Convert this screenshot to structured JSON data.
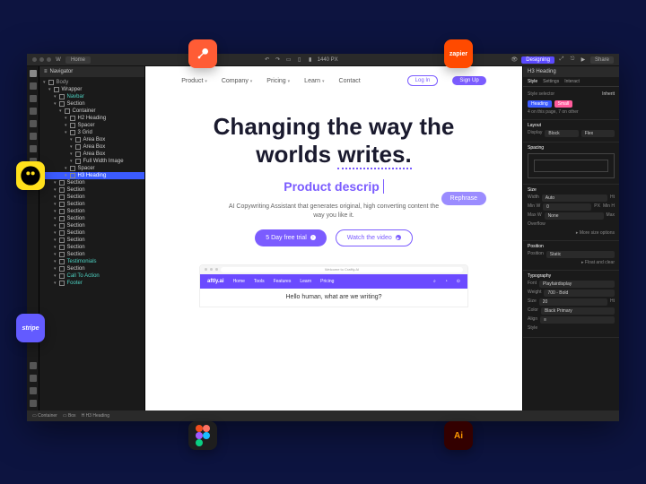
{
  "topbar": {
    "home": "Home",
    "width": "1440 PX",
    "designing": "Designing",
    "share": "Share"
  },
  "navigator": {
    "title": "Navigator",
    "tree": [
      {
        "label": "Body",
        "cls": "root"
      },
      {
        "label": "Wrapper",
        "cls": "ind1"
      },
      {
        "label": "Navbar",
        "cls": "ind2 teal"
      },
      {
        "label": "Section",
        "cls": "ind2"
      },
      {
        "label": "Container",
        "cls": "ind3"
      },
      {
        "label": "H2 Heading",
        "cls": "ind4"
      },
      {
        "label": "Spacer",
        "cls": "ind4"
      },
      {
        "label": "3 Grid",
        "cls": "ind4"
      },
      {
        "label": "Area Box",
        "cls": "ind5"
      },
      {
        "label": "Area Box",
        "cls": "ind5"
      },
      {
        "label": "Area Box",
        "cls": "ind5"
      },
      {
        "label": "Full Width Image",
        "cls": "ind5"
      },
      {
        "label": "Spacer",
        "cls": "ind4"
      },
      {
        "label": "H3 Heading",
        "cls": "ind4 sel"
      },
      {
        "label": "Section",
        "cls": "ind2"
      },
      {
        "label": "Section",
        "cls": "ind2"
      },
      {
        "label": "Section",
        "cls": "ind2"
      },
      {
        "label": "Section",
        "cls": "ind2"
      },
      {
        "label": "Section",
        "cls": "ind2"
      },
      {
        "label": "Section",
        "cls": "ind2"
      },
      {
        "label": "Section",
        "cls": "ind2"
      },
      {
        "label": "Section",
        "cls": "ind2"
      },
      {
        "label": "Section",
        "cls": "ind2"
      },
      {
        "label": "Section",
        "cls": "ind2"
      },
      {
        "label": "Section",
        "cls": "ind2"
      },
      {
        "label": "Testimonials",
        "cls": "ind2 teal"
      },
      {
        "label": "Section",
        "cls": "ind2"
      },
      {
        "label": "Call To Action",
        "cls": "ind2 teal"
      },
      {
        "label": "Footer",
        "cls": "ind2 teal"
      }
    ]
  },
  "site": {
    "nav": [
      "Product",
      "Company",
      "Pricing",
      "Learn",
      "Contact"
    ],
    "login": "Log In",
    "signup": "Sign Up",
    "headline_a": "Changing the way the",
    "headline_b": "worlds ",
    "headline_c": "writes.",
    "rephrase": "Rephrase",
    "typed": "Product descrip",
    "sub": "AI Copywriting Assistant that generates original, high converting content the way you like it.",
    "cta_primary": "5 Day free trial",
    "cta_secondary": "Watch the video"
  },
  "preview": {
    "url": "Welcome to Craftly.AI",
    "logo": "aftly.ai",
    "nav": [
      "Home",
      "Tools",
      "Features",
      "Learn",
      "Pricing"
    ],
    "headline": "Hello human, what are we writing?"
  },
  "breadcrumb": [
    "Container",
    "Box",
    "H3 Heading"
  ],
  "panel": {
    "title": "H3 Heading",
    "tabs": [
      "Style",
      "Settings",
      "Interact"
    ],
    "selector": "Style selector",
    "inherit": "Inherit",
    "chips": [
      "Heading",
      "Small"
    ],
    "inherit_note": "4 on this page, 7 on other",
    "layout": "Layout",
    "display": "Display",
    "display_vals": [
      "Block",
      "Flex"
    ],
    "spacing": "Spacing",
    "size": "Size",
    "width": "Width",
    "width_v": "Auto",
    "height": "Ht",
    "minw": "Min W",
    "minw_v": "0",
    "minh": "PX",
    "minh2": "Min H",
    "maxw": "Max W",
    "maxw_v": "None",
    "maxh": "Max",
    "overflow": "Overflow",
    "more": "More size options",
    "position": "Position",
    "pos_v": "Static",
    "float": "Float and clear",
    "typo": "Typography",
    "font": "Font",
    "font_v": "Playfairdisplay",
    "weight": "Weight",
    "weight_v": "700 - Bold",
    "sizet": "Size",
    "size_v": "20",
    "size_u": "Ht",
    "color": "Color",
    "color_v": "Black Primary",
    "align": "Align",
    "style": "Style"
  },
  "badges": {
    "zapier": "zapier",
    "stripe": "stripe",
    "ai": "Ai"
  }
}
